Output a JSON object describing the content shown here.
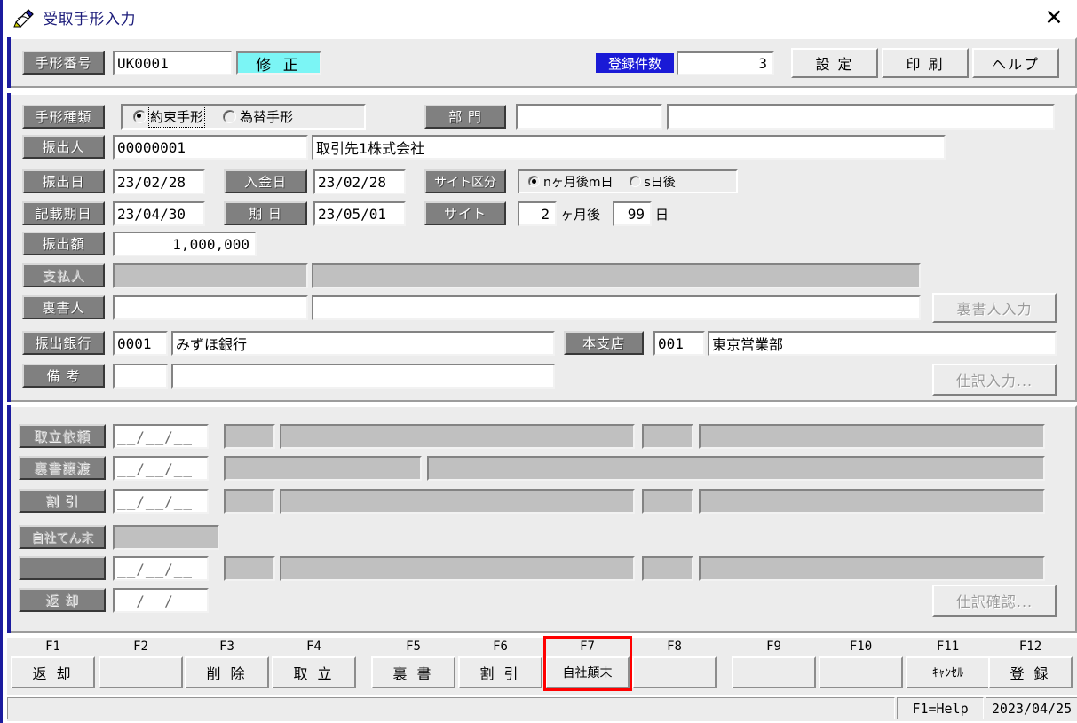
{
  "window": {
    "title": "受取手形入力",
    "icon": "pen-note-icon",
    "close_label": "✕"
  },
  "header": {
    "bill_no_label": "手形番号",
    "bill_no_value": "UK0001",
    "mode_badge": "修 正",
    "count_label": "登録件数",
    "count_value": "3",
    "buttons": [
      {
        "name": "settings",
        "label": "設 定"
      },
      {
        "name": "print",
        "label": "印 刷"
      },
      {
        "name": "help",
        "label": "ヘルプ"
      }
    ]
  },
  "form": {
    "bill_type_label": "手形種類",
    "bill_type_options": [
      {
        "label": "約束手形",
        "selected": true
      },
      {
        "label": "為替手形",
        "selected": false
      }
    ],
    "dept_label": "部 門",
    "dept_code": "",
    "dept_name": "",
    "drawer_label": "振出人",
    "drawer_code": "00000001",
    "drawer_name": "取引先1株式会社",
    "issue_date_label": "振出日",
    "issue_date_value": "23/02/28",
    "receipt_date_label": "入金日",
    "receipt_date_value": "23/02/28",
    "site_class_label": "サイト区分",
    "site_class_options": [
      {
        "label": "nヶ月後m日",
        "selected": true
      },
      {
        "label": "s日後",
        "selected": false
      }
    ],
    "written_due_label": "記載期日",
    "written_due_value": "23/04/30",
    "due_date_label": "期 日",
    "due_date_value": "23/05/01",
    "site_label": "サイト",
    "site_months_value": "2",
    "site_months_suffix": "ヶ月後",
    "site_days_value": "99",
    "site_days_suffix": "日",
    "amount_label": "振出額",
    "amount_value": "1,000,000",
    "payer_label": "支払人",
    "payer_code": "",
    "payer_name": "",
    "endorser_label": "裏書人",
    "endorser_code": "",
    "endorser_name": "",
    "endorser_input_button": "裏書人入力",
    "bank_label": "振出銀行",
    "bank_code": "0001",
    "bank_name": "みずほ銀行",
    "branch_label": "本支店",
    "branch_code": "001",
    "branch_name": "東京営業部",
    "note_label": "備  考",
    "note_code": "",
    "note_text": "",
    "journal_input_button": "仕訳入力..."
  },
  "history": {
    "date_mask": "__/__/__",
    "rows": [
      {
        "label": "取立依頼",
        "date": "__/__/__",
        "layout": "split"
      },
      {
        "label": "裏書譲渡",
        "date": "__/__/__",
        "layout": "wide"
      },
      {
        "label": "割  引",
        "date": "__/__/__",
        "layout": "split"
      },
      {
        "label": "自社てん末",
        "date": "",
        "layout": "single"
      },
      {
        "label": "",
        "date": "__/__/__",
        "layout": "split"
      },
      {
        "label": "返  却",
        "date": "__/__/__",
        "layout": "none"
      }
    ],
    "journal_confirm_button": "仕訳確認..."
  },
  "fkeys": [
    {
      "key": "F1",
      "label": "返 却",
      "highlight": false
    },
    {
      "key": "F2",
      "label": "",
      "highlight": false
    },
    {
      "key": "F3",
      "label": "削 除",
      "highlight": false
    },
    {
      "key": "F4",
      "label": "取 立",
      "highlight": false
    },
    {
      "key": "F5",
      "label": "裏 書",
      "highlight": false
    },
    {
      "key": "F6",
      "label": "割 引",
      "highlight": false
    },
    {
      "key": "F7",
      "label": "自社顛末",
      "highlight": true
    },
    {
      "key": "F8",
      "label": "",
      "highlight": false
    },
    {
      "key": "F9",
      "label": "",
      "highlight": false
    },
    {
      "key": "F10",
      "label": "",
      "highlight": false
    },
    {
      "key": "F11",
      "label": "ｷｬﾝｾﾙ",
      "highlight": false
    },
    {
      "key": "F12",
      "label": "登 録",
      "highlight": false
    }
  ],
  "statusbar": {
    "help_hint": "F1=Help",
    "date": "2023/04/25"
  },
  "colors": {
    "accent_blue": "#1b1b9e",
    "badge_cyan": "#7bf5f5",
    "highlight_red": "#ff0000",
    "label_gray": "#808080",
    "face": "#ececec"
  }
}
